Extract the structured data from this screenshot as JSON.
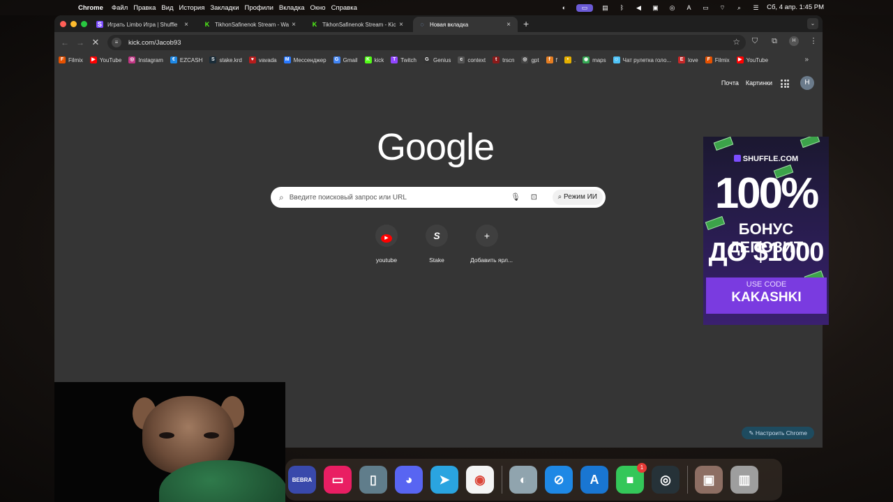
{
  "menubar": {
    "app": "Chrome",
    "items": [
      "Файл",
      "Правка",
      "Вид",
      "История",
      "Закладки",
      "Профили",
      "Вкладка",
      "Окно",
      "Справка"
    ],
    "datetime": "Сб, 4 апр.  1:45 PM"
  },
  "tabs": [
    {
      "label": "Играть Limbo Игра | Shuffle",
      "icon": "shuffle-icon",
      "color": "#7c4dff"
    },
    {
      "label": "TikhonSafinenok Stream - Wa",
      "icon": "kick-icon",
      "color": "#53fc18"
    },
    {
      "label": "TikhonSafinenok Stream - Kic",
      "icon": "kick-icon",
      "color": "#53fc18"
    },
    {
      "label": "Новая вкладка",
      "icon": "loading-icon",
      "color": "#8ab4f8"
    }
  ],
  "omnibox": {
    "url": "kick.com/Jacob93"
  },
  "bookmarks": [
    {
      "label": "Filmix",
      "color": "#e65100",
      "glyph": "F"
    },
    {
      "label": "YouTube",
      "color": "#ff0000",
      "glyph": "▶"
    },
    {
      "label": "Instagram",
      "color": "#c13584",
      "glyph": "◎"
    },
    {
      "label": "EZCASH",
      "color": "#1e88e5",
      "glyph": "€"
    },
    {
      "label": "stake.krd",
      "color": "#1a2c38",
      "glyph": "S"
    },
    {
      "label": "vavada",
      "color": "#b71c1c",
      "glyph": "♥"
    },
    {
      "label": "Мессенджер",
      "color": "#2979ff",
      "glyph": "M"
    },
    {
      "label": "Gmail",
      "color": "#4285f4",
      "glyph": "G"
    },
    {
      "label": "kick",
      "color": "#53fc18",
      "glyph": "K"
    },
    {
      "label": "Twitch",
      "color": "#9146ff",
      "glyph": "T"
    },
    {
      "label": "Genius",
      "color": "#333333",
      "glyph": "G"
    },
    {
      "label": "context",
      "color": "#555555",
      "glyph": "c"
    },
    {
      "label": "trscn",
      "color": "#8b1a1a",
      "glyph": "t"
    },
    {
      "label": "gpt",
      "color": "#444444",
      "glyph": "◎"
    },
    {
      "label": "f",
      "color": "#e67e22",
      "glyph": "f"
    },
    {
      "label": ".",
      "color": "#e5b000",
      "glyph": "•"
    },
    {
      "label": "maps",
      "color": "#34a853",
      "glyph": "◉"
    },
    {
      "label": "Чат рулетка голо...",
      "color": "#4fc3f7",
      "glyph": "☺"
    },
    {
      "label": "love",
      "color": "#c62828",
      "glyph": "E"
    },
    {
      "label": "Filmix",
      "color": "#e65100",
      "glyph": "F"
    },
    {
      "label": "YouTube",
      "color": "#ff0000",
      "glyph": "▶"
    }
  ],
  "ntp": {
    "links": [
      "Почта",
      "Картинки"
    ],
    "avatar": "H",
    "logo": "Google",
    "search_placeholder": "Введите поисковый запрос или URL",
    "ai_mode": "Режим ИИ",
    "shortcuts": [
      {
        "label": "youtube",
        "glyph": "▶",
        "color": "#ff0000"
      },
      {
        "label": "Stake",
        "glyph": "S",
        "color": "#ffffff"
      },
      {
        "label": "Добавить ярл...",
        "glyph": "+",
        "color": "#ffffff"
      }
    ],
    "customize": "Настроить Chrome"
  },
  "ad": {
    "brand": "SHUFFLE.COM",
    "headline": "100%",
    "line2": "БОНУС ДЕПОЗИТ",
    "line3": "ДО $1000",
    "code_label": "USE CODE",
    "code": "KAKASHKI"
  },
  "dock": [
    {
      "name": "bebra-app",
      "glyph": "BEBRA",
      "bg": "#3949ab"
    },
    {
      "name": "cleanmymac-app",
      "glyph": "▭",
      "bg": "#e91e63"
    },
    {
      "name": "iphone-mirroring-app",
      "glyph": "▯",
      "bg": "#607d8b"
    },
    {
      "name": "discord-app",
      "glyph": "◕",
      "bg": "#5865f2"
    },
    {
      "name": "telegram-app",
      "glyph": "➤",
      "bg": "#2aa4e0"
    },
    {
      "name": "chrome-app",
      "glyph": "◉",
      "bg": "#f4f4f4"
    },
    {
      "name": "finder-app",
      "glyph": "◐",
      "bg": "#90a4ae"
    },
    {
      "name": "safari-app",
      "glyph": "⊘",
      "bg": "#1e88e5"
    },
    {
      "name": "app-store-app",
      "glyph": "A",
      "bg": "#1976d2"
    },
    {
      "name": "facetime-app",
      "glyph": "■",
      "bg": "#34c759",
      "badge": "1"
    },
    {
      "name": "obs-app",
      "glyph": "◎",
      "bg": "#263238"
    },
    {
      "name": "downloads-stack",
      "glyph": "▣",
      "bg": "#8d6e63"
    },
    {
      "name": "trash",
      "glyph": "▥",
      "bg": "#9e9e9e"
    }
  ]
}
